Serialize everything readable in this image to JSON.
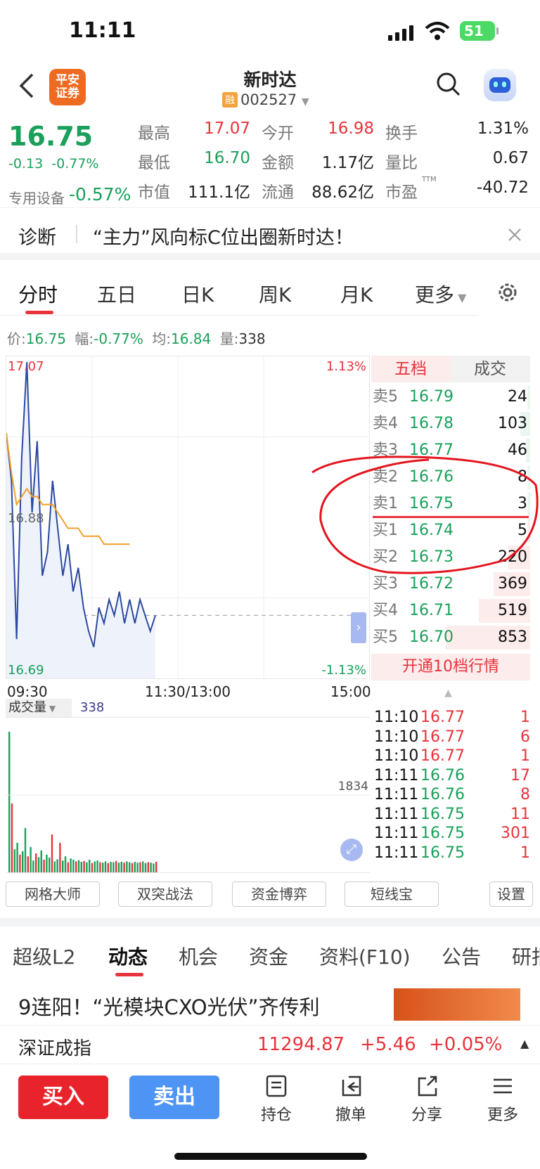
{
  "status": {
    "time": "11:11",
    "battery": "51"
  },
  "header": {
    "broker": "平安证券",
    "broker_line1": "平安",
    "broker_line2": "证券",
    "title": "新时达",
    "rong": "融",
    "code": "002527"
  },
  "quote": {
    "price": "16.75",
    "change": "-0.13",
    "change_pct": "-0.77%",
    "sector": "专用设备",
    "sector_pct": "-0.57%",
    "fields": [
      {
        "label": "最高",
        "value": "17.07",
        "color": "red"
      },
      {
        "label": "今开",
        "value": "16.98",
        "color": "red"
      },
      {
        "label": "换手",
        "value": "1.31%",
        "color": "dark"
      },
      {
        "label": "最低",
        "value": "16.70",
        "color": "green"
      },
      {
        "label": "金额",
        "value": "1.17亿",
        "color": "dark"
      },
      {
        "label": "量比",
        "value": "0.67",
        "color": "dark"
      },
      {
        "label": "市值",
        "value": "111.1亿",
        "color": "dark"
      },
      {
        "label": "流通",
        "value": "88.62亿",
        "color": "dark"
      },
      {
        "label": "市盈",
        "value": "-40.72",
        "color": "dark",
        "sup": "TTM"
      }
    ]
  },
  "diagnosis": {
    "label": "诊断",
    "text": "“主力”风向标C位出圈新时达！"
  },
  "chart_tabs": [
    "分时",
    "五日",
    "日K",
    "周K",
    "月K",
    "更多"
  ],
  "info": {
    "price_label": "价:",
    "price": "16.75",
    "amp_label": "幅:",
    "amp": "-0.77%",
    "avg_label": "均:",
    "avg": "16.84",
    "vol_label": "量:",
    "vol": "338"
  },
  "chart_data": {
    "type": "line",
    "y_high": "17.07",
    "y_mid": "16.88",
    "y_low": "16.69",
    "pct_high": "1.13%",
    "pct_low": "-1.13%",
    "x_labels": [
      "09:30",
      "11:30/13:00",
      "15:00"
    ],
    "series": [
      {
        "values": [
          16.98,
          16.92,
          16.72,
          16.95,
          17.07,
          16.88,
          16.97,
          16.8,
          16.83,
          16.92,
          16.86,
          16.8,
          16.84,
          16.78,
          16.81,
          16.76,
          16.73,
          16.71,
          16.76,
          16.74,
          16.77,
          16.75,
          16.78,
          16.74,
          16.77,
          16.74,
          16.77,
          16.75,
          16.73,
          16.75
        ]
      },
      {
        "values": [
          16.98,
          16.93,
          16.89,
          16.9,
          16.91,
          16.9,
          16.9,
          16.89,
          16.89,
          16.89,
          16.88,
          16.87,
          16.86,
          16.86,
          16.86,
          16.85,
          16.85,
          16.85,
          16.85,
          16.84,
          16.84,
          16.84,
          16.84,
          16.84,
          16.84
        ]
      }
    ],
    "volume": {
      "label": "成交量",
      "current": "338",
      "max_label": "1834"
    }
  },
  "orderbook": {
    "tabs": [
      "五档",
      "成交"
    ],
    "asks": [
      {
        "label": "卖5",
        "price": "16.79",
        "vol": "24"
      },
      {
        "label": "卖4",
        "price": "16.78",
        "vol": "103"
      },
      {
        "label": "卖3",
        "price": "16.77",
        "vol": "46"
      },
      {
        "label": "卖2",
        "price": "16.76",
        "vol": "8"
      },
      {
        "label": "卖1",
        "price": "16.75",
        "vol": "3"
      }
    ],
    "bids": [
      {
        "label": "买1",
        "price": "16.74",
        "vol": "5"
      },
      {
        "label": "买2",
        "price": "16.73",
        "vol": "220"
      },
      {
        "label": "买3",
        "price": "16.72",
        "vol": "369"
      },
      {
        "label": "买4",
        "price": "16.71",
        "vol": "519"
      },
      {
        "label": "买5",
        "price": "16.70",
        "vol": "853"
      }
    ],
    "upgrade": "开通10档行情"
  },
  "trades": [
    {
      "time": "11:10",
      "price": "16.77",
      "vol": "1"
    },
    {
      "time": "11:10",
      "price": "16.77",
      "vol": "6"
    },
    {
      "time": "11:10",
      "price": "16.77",
      "vol": "1"
    },
    {
      "time": "11:11",
      "price": "16.76",
      "vol": "17"
    },
    {
      "time": "11:11",
      "price": "16.76",
      "vol": "8"
    },
    {
      "time": "11:11",
      "price": "16.75",
      "vol": "11"
    },
    {
      "time": "11:11",
      "price": "16.75",
      "vol": "301"
    },
    {
      "time": "11:11",
      "price": "16.75",
      "vol": "1"
    }
  ],
  "tools": [
    "网格大师",
    "双突战法",
    "资金博弈",
    "短线宝",
    "设置"
  ],
  "sections": [
    "超级L2",
    "动态",
    "机会",
    "资金",
    "资料(F10)",
    "公告",
    "研报"
  ],
  "news": {
    "headline": "9连阳！“光模块CXO光伏”齐传利"
  },
  "index": {
    "name": "深证成指",
    "value": "11294.87",
    "change": "+5.46",
    "pct": "+0.05%"
  },
  "actions": {
    "buy": "买入",
    "sell": "卖出",
    "items": [
      "持仓",
      "撤单",
      "分享",
      "更多"
    ]
  }
}
